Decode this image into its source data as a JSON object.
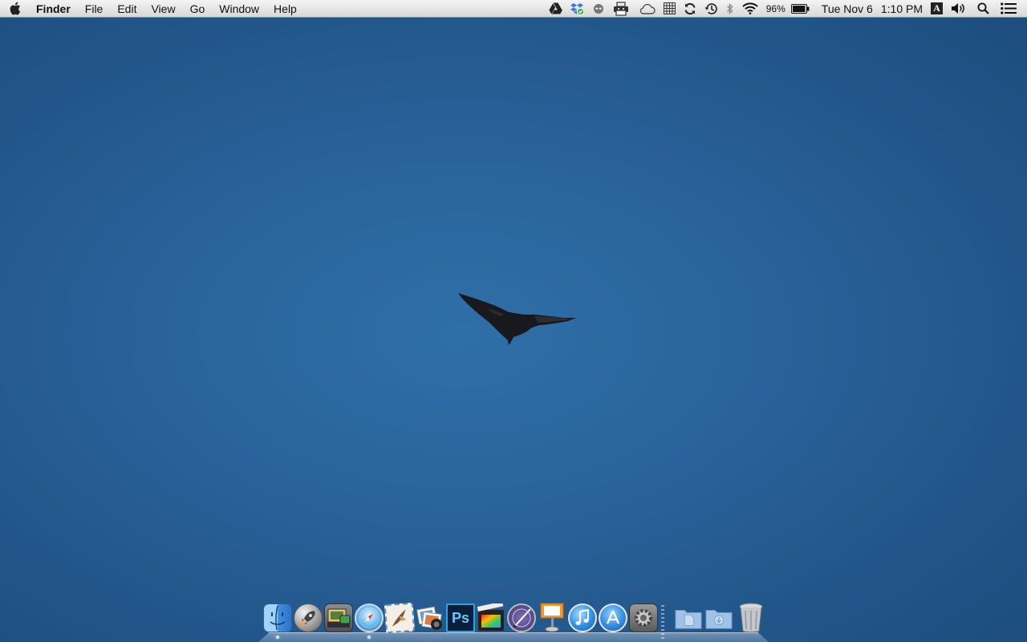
{
  "menubar": {
    "apple_icon": "apple-icon",
    "app_name": "Finder",
    "menus": [
      "File",
      "Edit",
      "View",
      "Go",
      "Window",
      "Help"
    ],
    "status_icons": [
      "google-drive-icon",
      "dropbox-icon",
      "alien-app-icon",
      "printer-activity-icon",
      "icloud-icon",
      "grid-app-icon",
      "sync-icon",
      "time-machine-icon",
      "bluetooth-icon",
      "wifi-icon"
    ],
    "battery_percent": "96%",
    "battery_level": 0.96,
    "date": "Tue Nov 6",
    "time": "1:10 PM",
    "input_source": "A",
    "right_icons": [
      "volume-icon",
      "spotlight-icon",
      "notification-center-icon"
    ]
  },
  "desktop": {
    "wallpaper": "bird soaring in blue sky",
    "sky_color": "#2a649c"
  },
  "dock": {
    "apps": [
      {
        "icon": "finder-icon",
        "running": true
      },
      {
        "icon": "launchpad-icon",
        "running": false
      },
      {
        "icon": "image-capture-icon",
        "running": false
      },
      {
        "icon": "safari-icon",
        "running": true
      },
      {
        "icon": "mail-icon",
        "running": false
      },
      {
        "icon": "iphoto-icon",
        "running": false
      },
      {
        "icon": "photoshop-icon",
        "running": false
      },
      {
        "icon": "final-cut-pro-icon",
        "running": false
      },
      {
        "icon": "aperture-icon",
        "running": false
      },
      {
        "icon": "keynote-icon",
        "running": false
      },
      {
        "icon": "itunes-icon",
        "running": false
      },
      {
        "icon": "app-store-icon",
        "running": false
      },
      {
        "icon": "system-preferences-icon",
        "running": false
      }
    ],
    "stacks": [
      {
        "icon": "documents-folder-icon"
      },
      {
        "icon": "downloads-folder-icon"
      },
      {
        "icon": "trash-icon"
      }
    ],
    "photoshop_label": "Ps"
  }
}
